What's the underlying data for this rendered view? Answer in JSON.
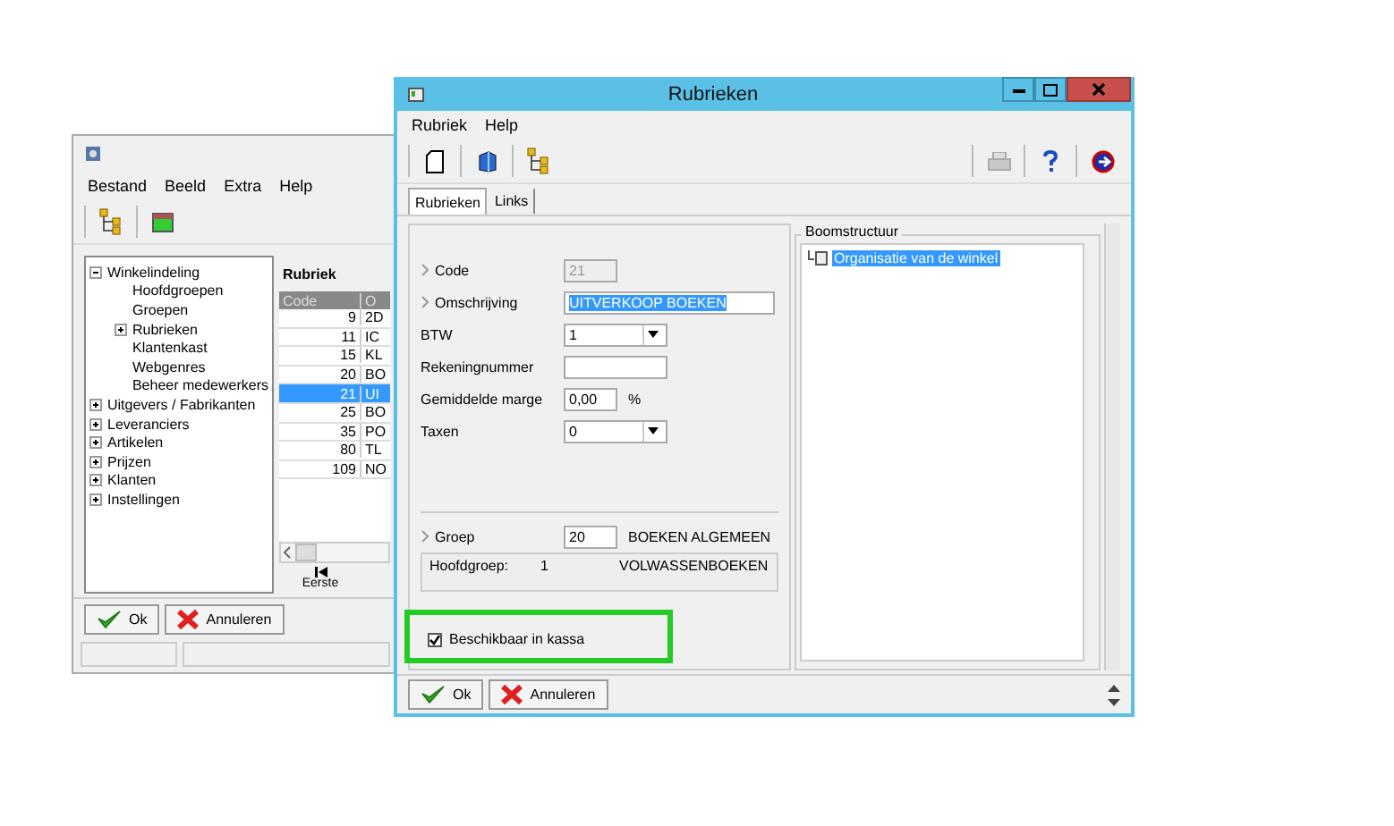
{
  "back_window": {
    "menu": [
      "Bestand",
      "Beeld",
      "Extra",
      "Help"
    ],
    "tree": [
      {
        "label": "Winkelindeling",
        "kind": "folder",
        "expanded": true,
        "children": [
          {
            "label": "Hoofdgroepen",
            "kind": "leaf"
          },
          {
            "label": "Groepen",
            "kind": "leaf"
          },
          {
            "label": "Rubrieken",
            "kind": "folder",
            "expanded": false
          },
          {
            "label": "Klantenkast",
            "kind": "leaf"
          },
          {
            "label": "Webgenres",
            "kind": "leaf"
          },
          {
            "label": "Beheer medewerkers",
            "kind": "leaf"
          }
        ]
      },
      {
        "label": "Uitgevers / Fabrikanten",
        "kind": "folder",
        "expanded": false
      },
      {
        "label": "Leveranciers",
        "kind": "folder",
        "expanded": false
      },
      {
        "label": "Artikelen",
        "kind": "folder",
        "expanded": false
      },
      {
        "label": "Prijzen",
        "kind": "folder",
        "expanded": false
      },
      {
        "label": "Klanten",
        "kind": "folder",
        "expanded": false
      },
      {
        "label": "Instellingen",
        "kind": "folder",
        "expanded": false
      }
    ],
    "grid": {
      "title": "Rubriek",
      "columns": [
        "Code",
        "O"
      ],
      "rows": [
        {
          "cells": [
            "9",
            "2D"
          ],
          "selected": false
        },
        {
          "cells": [
            "11",
            "IC"
          ],
          "selected": false
        },
        {
          "cells": [
            "15",
            "KL"
          ],
          "selected": false
        },
        {
          "cells": [
            "20",
            "BO"
          ],
          "selected": false
        },
        {
          "cells": [
            "21",
            "UI"
          ],
          "selected": true
        },
        {
          "cells": [
            "25",
            "BO"
          ],
          "selected": false
        },
        {
          "cells": [
            "35",
            "PO"
          ],
          "selected": false
        },
        {
          "cells": [
            "80",
            "TL"
          ],
          "selected": false
        },
        {
          "cells": [
            "109",
            "NO"
          ],
          "selected": false
        }
      ]
    },
    "nav_button": "Eerste",
    "buttons": [
      {
        "label": "Ok",
        "kind": "ok"
      },
      {
        "label": "Annuleren",
        "kind": "cancel"
      }
    ]
  },
  "front_window": {
    "title": "Rubrieken",
    "menu": [
      "Rubriek",
      "Help"
    ],
    "tabs": [
      {
        "label": "Rubrieken",
        "selected": true
      },
      {
        "label": "Links",
        "selected": false
      }
    ],
    "fields": [
      {
        "label": "Code",
        "kind": "readonly",
        "value": "21",
        "lookup": true
      },
      {
        "label": "Omschrijving",
        "kind": "text",
        "value": "UITVERKOOP BOEKEN",
        "lookup": true,
        "text_selected": true
      },
      {
        "label": "BTW",
        "kind": "select",
        "value": "1",
        "lookup": false
      },
      {
        "label": "Rekeningnummer",
        "kind": "text",
        "lookup": false
      },
      {
        "label": "Gemiddelde marge",
        "kind": "text",
        "value": "0,00",
        "unit": "%",
        "lookup": false
      },
      {
        "label": "Taxen",
        "kind": "select",
        "value": "0",
        "lookup": false
      }
    ],
    "groep": {
      "label": "Groep",
      "value": "20",
      "name": "BOEKEN ALGEMEEN"
    },
    "hoofdgroep": {
      "label": "Hoofdgroep:",
      "code": "1",
      "name": "VOLWASSENBOEKEN"
    },
    "checkbox": {
      "label": "Beschikbaar in kassa",
      "checked": true,
      "highlighted": true
    },
    "tree": {
      "title": "Boomstructuur",
      "items": [
        {
          "label": "Organisatie van de winkel",
          "selected": true
        }
      ]
    },
    "buttons": [
      {
        "label": "Ok",
        "kind": "ok"
      },
      {
        "label": "Annuleren",
        "kind": "cancel"
      }
    ]
  }
}
